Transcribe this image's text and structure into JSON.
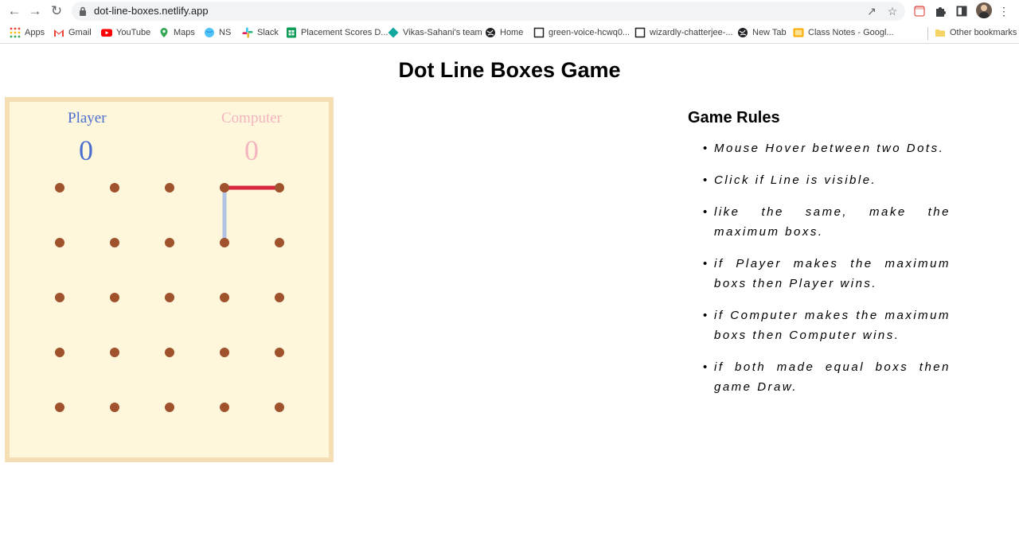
{
  "browser": {
    "url": "dot-line-boxes.netlify.app",
    "bookmarks": [
      "Apps",
      "Gmail",
      "YouTube",
      "Maps",
      "NS",
      "Slack",
      "Placement Scores D...",
      "Vikas-Sahani's team",
      "Home",
      "green-voice-hcwq0...",
      "wizardly-chatterjee-...",
      "New Tab",
      "Class Notes - Googl..."
    ],
    "other_bookmarks": "Other bookmarks"
  },
  "game": {
    "title": "Dot Line Boxes Game",
    "player_label": "Player",
    "player_score": "0",
    "computer_label": "Computer",
    "computer_score": "0",
    "grid": {
      "rows": 5,
      "cols": 5,
      "drawn_lines": [
        {
          "from": [
            0,
            3
          ],
          "to": [
            0,
            4
          ],
          "owner": "computer",
          "color": "#d7263d"
        },
        {
          "from": [
            0,
            3
          ],
          "to": [
            1,
            3
          ],
          "owner": "hover",
          "color": "#b3c3e6"
        }
      ]
    },
    "colors": {
      "dot": "#a0522d",
      "player": "#4a6fcf",
      "computer": "#f4b4c0",
      "board_bg": "#fef7dc",
      "board_border": "#f5deb3"
    }
  },
  "rules": {
    "title": "Game Rules",
    "items": [
      "Mouse Hover between two Dots.",
      "Click if Line is visible.",
      "like the same, make the maximum boxs.",
      "if Player makes the maximum boxs then Player wins.",
      "if Computer makes the maximum boxs then Computer wins.",
      "if both made equal boxs then game Draw."
    ]
  }
}
